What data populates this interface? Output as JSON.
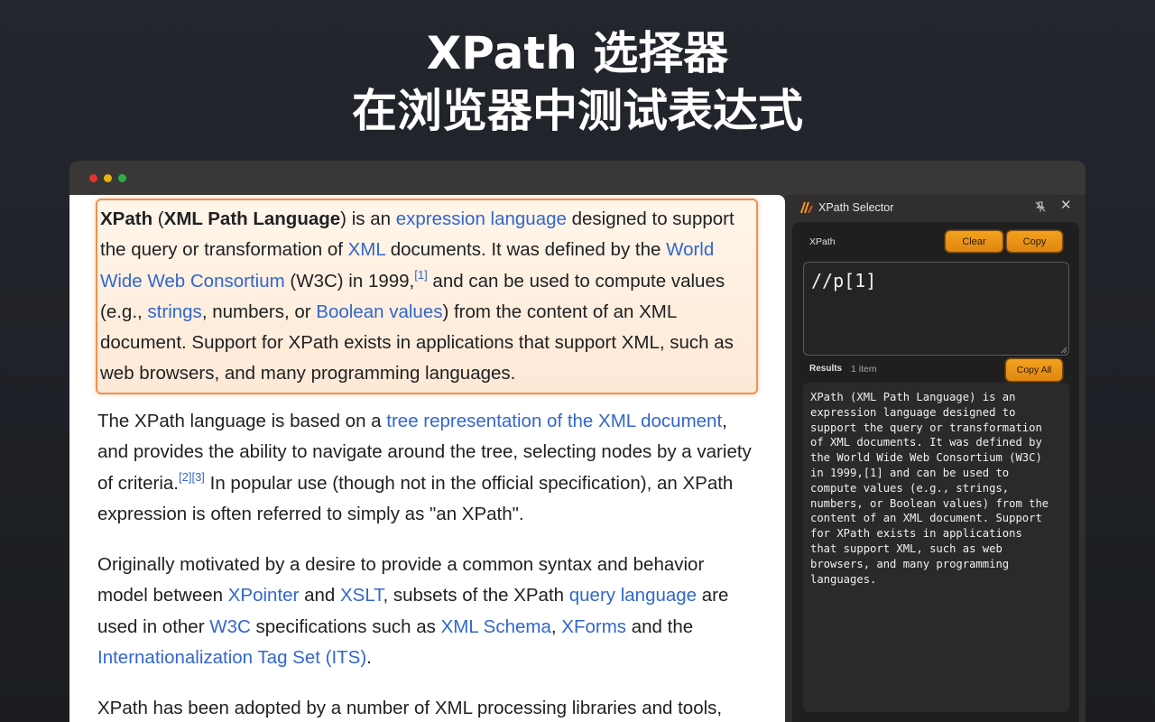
{
  "headline": {
    "line1": "XPath 选择器",
    "line2": "在浏览器中测试表达式"
  },
  "article": {
    "p1": {
      "b1": "XPath",
      "t1": " (",
      "b2": "XML Path Language",
      "t2": ") is an ",
      "l1": "expression language",
      "t3": " designed to support the query or transformation of ",
      "l2": "XML",
      "t4": " documents. It was defined by the ",
      "l3": "World Wide Web Consortium",
      "t5": " (W3C) in 1999,",
      "s1": "[1]",
      "t6": " and can be used to compute values (e.g., ",
      "l4": "strings",
      "t7": ", numbers, or ",
      "l5": "Boolean values",
      "t8": ") from the content of an XML document. Support for XPath exists in applications that support XML, such as web browsers, and many programming languages."
    },
    "p2": {
      "t1": "The XPath language is based on a ",
      "l1": "tree representation of the XML document",
      "t2": ", and provides the ability to navigate around the tree, selecting nodes by a variety of criteria.",
      "s1": "[2]",
      "s2": "[3]",
      "t3": " In popular use (though not in the official specification), an XPath expression is often referred to simply as \"an XPath\"."
    },
    "p3": {
      "t1": "Originally motivated by a desire to provide a common syntax and behavior model between ",
      "l1": "XPointer",
      "t2": " and ",
      "l2": "XSLT",
      "t3": ", subsets of the XPath ",
      "l3": "query language",
      "t4": " are used in other ",
      "l4": "W3C",
      "t5": " specifications such as ",
      "l5": "XML Schema",
      "t6": ", ",
      "l6": "XForms",
      "t7": " and the ",
      "l7": "Internationalization Tag Set (ITS)",
      "t8": "."
    },
    "p4": {
      "t1": "XPath has been adopted by a number of XML processing libraries and tools,"
    }
  },
  "panel": {
    "title": "XPath Selector",
    "xpath_label": "XPath",
    "clear_label": "Clear",
    "copy_label": "Copy",
    "xpath_value": "//p[1]",
    "results_label": "Results",
    "results_count": "1 item",
    "copy_all_label": "Copy All",
    "result_text": "XPath (XML Path Language) is an\nexpression language designed to\nsupport the query or transformation\nof XML documents. It was defined by\nthe World Wide Web Consortium (W3C)\nin 1999,[1] and can be used to\ncompute values (e.g., strings,\nnumbers, or Boolean values) from the\ncontent of an XML document. Support\nfor XPath exists in applications\nthat support XML, such as web\nbrowsers, and many programming\nlanguages."
  },
  "colors": {
    "accent": "#f0962a",
    "highlight_border": "#f0914f",
    "link": "#3366cc",
    "panel_bg": "#302e2e"
  }
}
